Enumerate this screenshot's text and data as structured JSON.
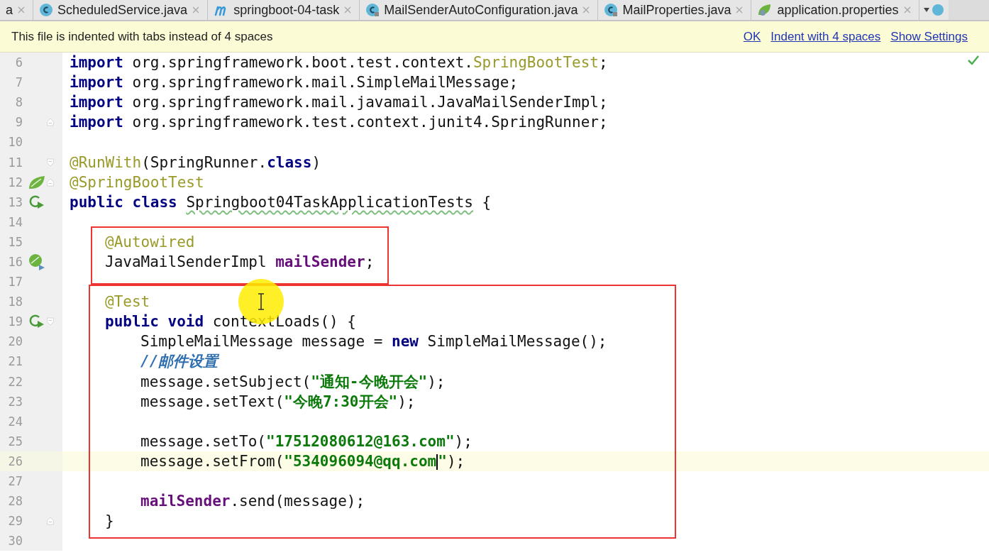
{
  "tabs": [
    {
      "label": "a"
    },
    {
      "label": "ScheduledService.java"
    },
    {
      "label": "springboot-04-task"
    },
    {
      "label": "MailSenderAutoConfiguration.java"
    },
    {
      "label": "MailProperties.java"
    },
    {
      "label": "application.properties"
    }
  ],
  "notification": {
    "message": "This file is indented with tabs instead of 4 spaces",
    "actions": [
      "OK",
      "Indent with 4 spaces",
      "Show Settings"
    ]
  },
  "lines": [
    {
      "number": "6",
      "tokens": [
        {
          "kind": "kw",
          "text": "import"
        },
        {
          "kind": "plain",
          "text": " org.springframework.boot.test.context."
        },
        {
          "kind": "ann",
          "text": "SpringBootTest"
        },
        {
          "kind": "plain",
          "text": ";"
        }
      ]
    },
    {
      "number": "7",
      "tokens": [
        {
          "kind": "kw",
          "text": "import"
        },
        {
          "kind": "plain",
          "text": " org.springframework.mail.SimpleMailMessage;"
        }
      ]
    },
    {
      "number": "8",
      "tokens": [
        {
          "kind": "kw",
          "text": "import"
        },
        {
          "kind": "plain",
          "text": " org.springframework.mail.javamail.JavaMailSenderImpl;"
        }
      ]
    },
    {
      "number": "9",
      "tokens": [
        {
          "kind": "kw",
          "text": "import"
        },
        {
          "kind": "plain",
          "text": " org.springframework.test.context.junit4.SpringRunner;"
        }
      ]
    },
    {
      "number": "10"
    },
    {
      "number": "11",
      "tokens": [
        {
          "kind": "ann",
          "text": "@RunWith"
        },
        {
          "kind": "plain",
          "text": "(SpringRunner."
        },
        {
          "kind": "kw",
          "text": "class"
        },
        {
          "kind": "plain",
          "text": ")"
        }
      ]
    },
    {
      "number": "12",
      "tokens": [
        {
          "kind": "ann",
          "text": "@SpringBootTest"
        }
      ]
    },
    {
      "number": "13",
      "tokens": [
        {
          "kind": "kw",
          "text": "public class "
        },
        {
          "kind": "typo",
          "text": "Springboot04TaskApplicationTests"
        },
        {
          "kind": "plain",
          "text": " {"
        }
      ],
      "children": [
        {
          "number": "14"
        },
        {
          "number": "15",
          "tokens": [
            {
              "kind": "ann",
              "text": "@Autowired"
            }
          ]
        },
        {
          "number": "16",
          "tokens": [
            {
              "kind": "plain",
              "text": "JavaMailSenderImpl "
            },
            {
              "kind": "field",
              "text": "mailSender"
            },
            {
              "kind": "plain",
              "text": ";"
            }
          ]
        },
        {
          "number": "17"
        },
        {
          "number": "18",
          "tokens": [
            {
              "kind": "ann",
              "text": "@Test"
            }
          ]
        },
        {
          "number": "19",
          "tokens": [
            {
              "kind": "kw",
              "text": "public void"
            },
            {
              "kind": "plain",
              "text": " contextLoads() {"
            }
          ],
          "children": [
            {
              "number": "20",
              "tokens": [
                {
                  "kind": "plain",
                  "text": "SimpleMailMessage message = "
                },
                {
                  "kind": "kw",
                  "text": "new"
                },
                {
                  "kind": "plain",
                  "text": " SimpleMailMessage();"
                }
              ]
            },
            {
              "number": "21",
              "tokens": [
                {
                  "kind": "comment",
                  "text": "//邮件设置"
                }
              ]
            },
            {
              "number": "22",
              "tokens": [
                {
                  "kind": "plain",
                  "text": "message.setSubject("
                },
                {
                  "kind": "str",
                  "text": "\"通知-今晚开会\""
                },
                {
                  "kind": "plain",
                  "text": ");"
                }
              ]
            },
            {
              "number": "23",
              "tokens": [
                {
                  "kind": "plain",
                  "text": "message.setText("
                },
                {
                  "kind": "str",
                  "text": "\"今晚7:30开会\""
                },
                {
                  "kind": "plain",
                  "text": ");"
                }
              ]
            },
            {
              "number": "24"
            },
            {
              "number": "25",
              "tokens": [
                {
                  "kind": "plain",
                  "text": "message.setTo("
                },
                {
                  "kind": "str",
                  "text": "\"17512080612@163.com\""
                },
                {
                  "kind": "plain",
                  "text": ");"
                }
              ]
            },
            {
              "number": "26",
              "current": true,
              "tokens": [
                {
                  "kind": "plain",
                  "text": "message.setFrom("
                },
                {
                  "kind": "str",
                  "text": "\"534096094@qq.com",
                  "caret": true
                },
                {
                  "kind": "str",
                  "text": "\""
                },
                {
                  "kind": "plain",
                  "text": ");"
                }
              ]
            },
            {
              "number": "27"
            },
            {
              "number": "28",
              "tokens": [
                {
                  "kind": "field",
                  "text": "mailSender"
                },
                {
                  "kind": "plain",
                  "text": ".send(message);"
                }
              ]
            }
          ]
        },
        {
          "number": "29",
          "tokens": [
            {
              "kind": "plain",
              "text": "}"
            }
          ]
        },
        {
          "number": "30"
        }
      ]
    }
  ]
}
